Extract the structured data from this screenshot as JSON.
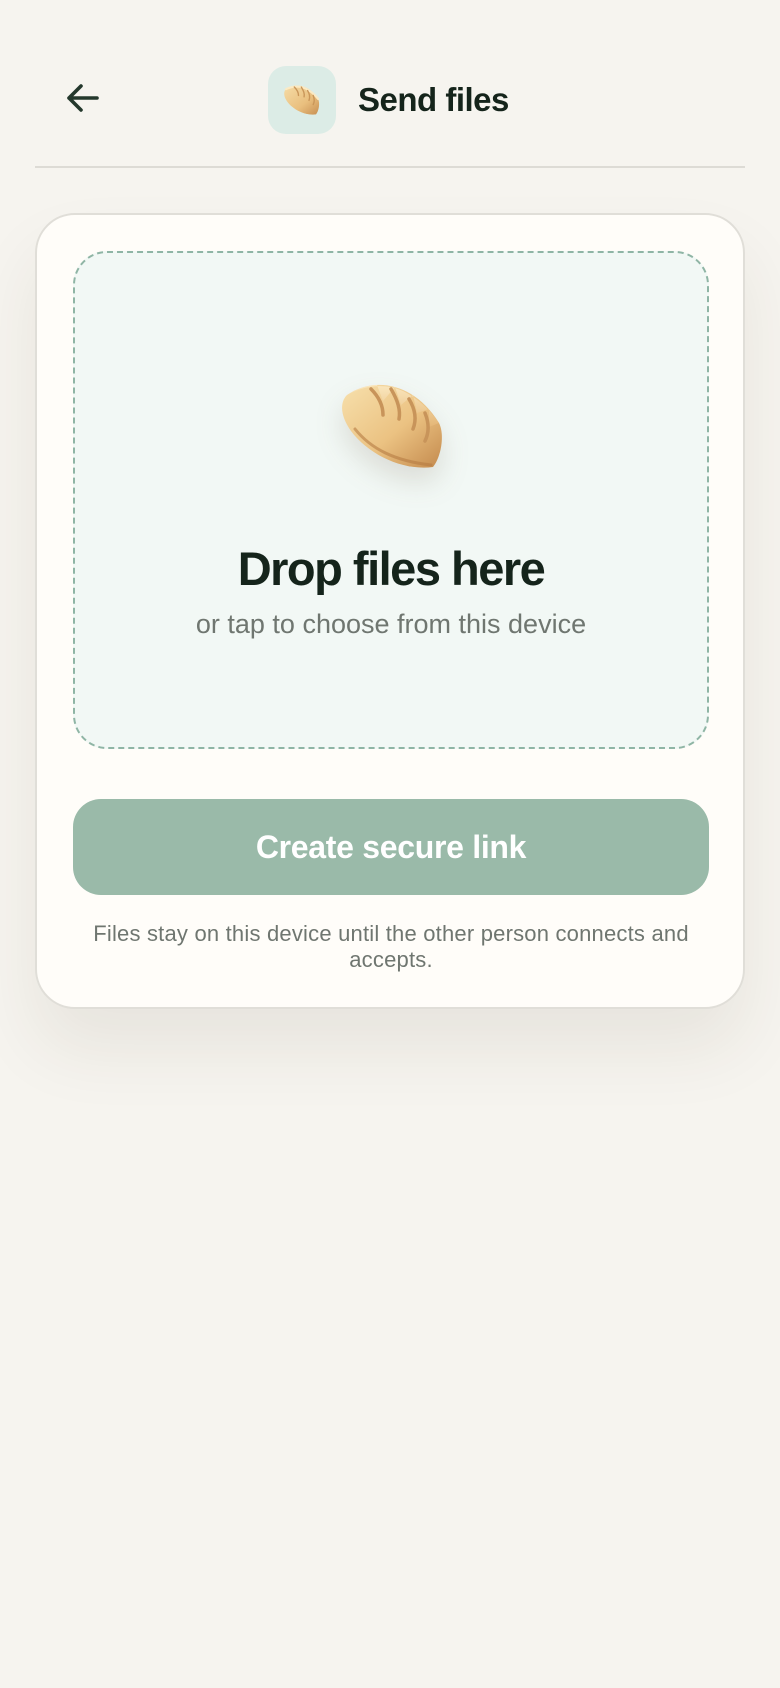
{
  "header": {
    "back_icon": "arrow-left-icon",
    "app_icon": "dumpling-icon",
    "title": "Send files"
  },
  "dropzone": {
    "icon": "dumpling-icon",
    "title": "Drop files here",
    "subtitle": "or tap to choose from this device"
  },
  "actions": {
    "create_link_label": "Create secure link",
    "note": "Files stay on this device until the other person connects and accepts."
  },
  "colors": {
    "background": "#f6f4ef",
    "card": "#fffdf9",
    "dropzone_bg": "#f2f8f5",
    "dropzone_border": "#8fb5a5",
    "button_bg": "#9abaa9",
    "app_icon_bg": "#dcece6",
    "text_primary": "#15241b",
    "text_secondary": "#6f7670"
  }
}
